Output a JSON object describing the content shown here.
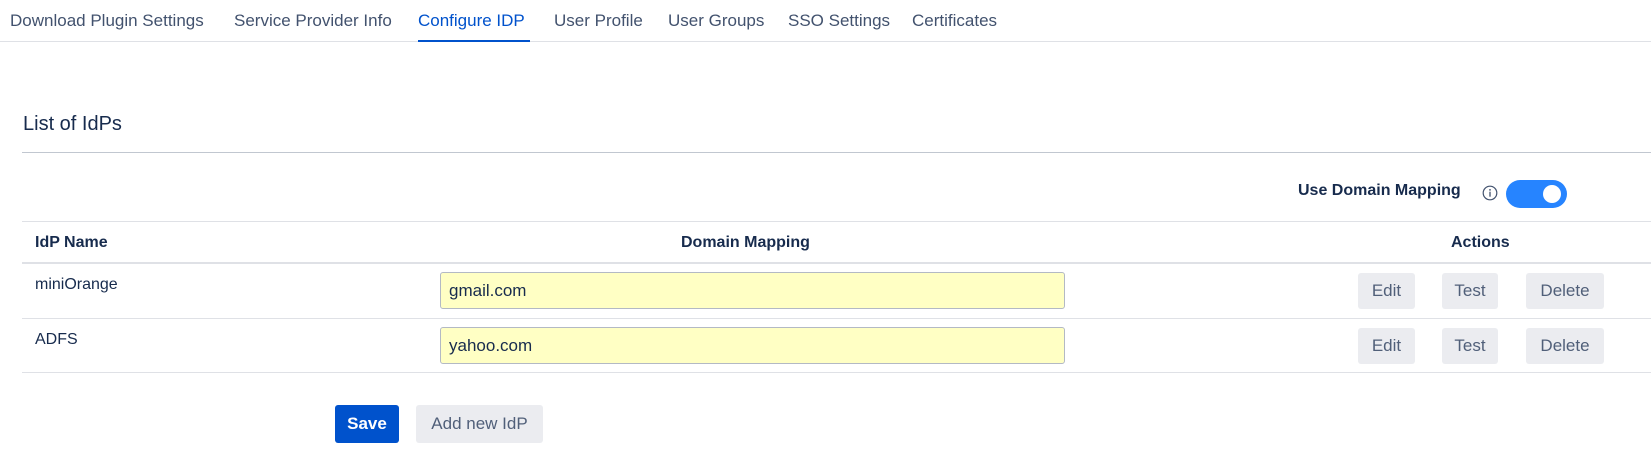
{
  "tabs": [
    {
      "label": "Download Plugin Settings",
      "active": false
    },
    {
      "label": "Service Provider Info",
      "active": false
    },
    {
      "label": "Configure IDP",
      "active": true
    },
    {
      "label": "User Profile",
      "active": false
    },
    {
      "label": "User Groups",
      "active": false
    },
    {
      "label": "SSO Settings",
      "active": false
    },
    {
      "label": "Certificates",
      "active": false
    }
  ],
  "section": {
    "title": "List of IdPs"
  },
  "domain_mapping_toggle": {
    "label": "Use Domain Mapping",
    "enabled": true,
    "info_icon": "info-circle-icon"
  },
  "table": {
    "headers": {
      "name": "IdP Name",
      "domain": "Domain Mapping",
      "actions": "Actions"
    },
    "rows": [
      {
        "name": "miniOrange",
        "domain": "gmail.com",
        "actions": {
          "edit": "Edit",
          "test": "Test",
          "delete": "Delete"
        }
      },
      {
        "name": "ADFS",
        "domain": "yahoo.com",
        "actions": {
          "edit": "Edit",
          "test": "Test",
          "delete": "Delete"
        }
      }
    ]
  },
  "footer": {
    "save_label": "Save",
    "add_label": "Add new IdP"
  },
  "colors": {
    "accent": "#0052cc",
    "toggle_on": "#2684ff",
    "input_fill": "#ffffc4"
  }
}
